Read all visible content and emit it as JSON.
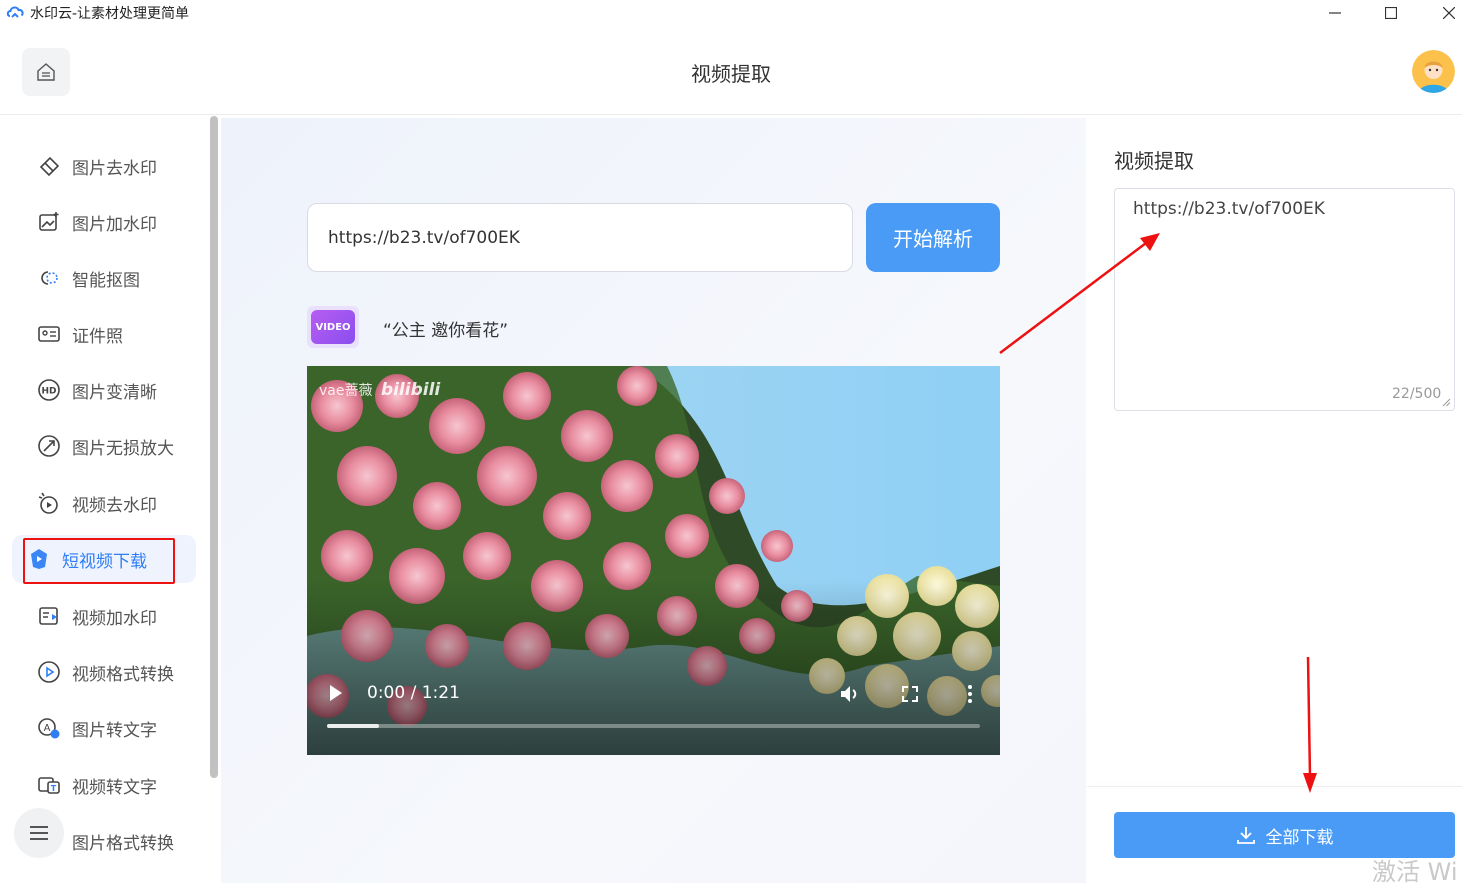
{
  "window": {
    "title": "水印云-让素材处理更简单",
    "controls": {
      "minimize": "—",
      "maximize": "☐",
      "close": "✕"
    }
  },
  "header": {
    "title": "视频提取"
  },
  "sidebar": {
    "items": [
      {
        "label": "图片去水印",
        "icon": "eraser-icon"
      },
      {
        "label": "图片加水印",
        "icon": "image-add-icon"
      },
      {
        "label": "智能抠图",
        "icon": "cutout-icon"
      },
      {
        "label": "证件照",
        "icon": "id-card-icon"
      },
      {
        "label": "图片变清晰",
        "icon": "hd-icon"
      },
      {
        "label": "图片无损放大",
        "icon": "enlarge-icon"
      },
      {
        "label": "视频去水印",
        "icon": "video-clean-icon"
      },
      {
        "label": "短视频下载",
        "icon": "short-video-icon",
        "active": true
      },
      {
        "label": "视频加水印",
        "icon": "video-mark-icon"
      },
      {
        "label": "视频格式转换",
        "icon": "video-convert-icon"
      },
      {
        "label": "图片转文字",
        "icon": "ocr-icon"
      },
      {
        "label": "视频转文字",
        "icon": "video-text-icon"
      },
      {
        "label": "图片格式转换",
        "icon": "image-convert-icon"
      }
    ]
  },
  "main": {
    "url_value": "https://b23.tv/of700EK",
    "parse_button": "开始解析",
    "video_badge": "VIDEO",
    "video_title": "“公主 邀你看花”",
    "player": {
      "time": "0:00 / 1:21",
      "watermark_text": "vae蔷薇",
      "brand": "bilibili",
      "progress": 0.08
    }
  },
  "right_panel": {
    "title": "视频提取",
    "textarea_value": "https://b23.tv/of700EK",
    "char_count": "22/500",
    "download_button": "全部下载"
  },
  "os_watermark": "激活 Wi",
  "colors": {
    "accent": "#4a9bf6",
    "annotation": "#e11111",
    "active_text": "#2f7ef5"
  }
}
